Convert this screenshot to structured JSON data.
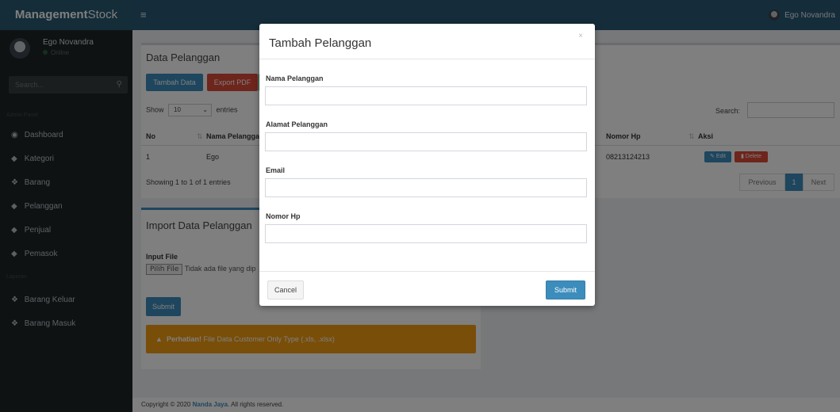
{
  "header": {
    "brand_bold": "Management",
    "brand_rest": "Stock",
    "menu_icon": "hamburger-icon",
    "user_name": "Ego Novandra"
  },
  "sidebar": {
    "user_name": "Ego Novandra",
    "status": "Online",
    "search_placeholder": "Search...",
    "section_admin": "Admin Panel",
    "section_report": "Laporan",
    "items": [
      {
        "label": "Dashboard",
        "icon": "dashboard-icon"
      },
      {
        "label": "Kategori",
        "icon": "tag-icon"
      },
      {
        "label": "Barang",
        "icon": "cubes-icon"
      },
      {
        "label": "Pelanggan",
        "icon": "tag-icon"
      },
      {
        "label": "Penjual",
        "icon": "tag-icon"
      },
      {
        "label": "Pemasok",
        "icon": "tag-icon"
      }
    ],
    "report_items": [
      {
        "label": "Barang Keluar",
        "icon": "cubes-icon"
      },
      {
        "label": "Barang Masuk",
        "icon": "cubes-icon"
      }
    ]
  },
  "data_box": {
    "title": "Data Pelanggan",
    "btn_add": "Tambah Data",
    "btn_pdf": "Export PDF",
    "show_label": "Show",
    "entries_value": "10",
    "entries_label": "entries",
    "search_label": "Search:",
    "columns": [
      "No",
      "Nama Pelanggan",
      "Nomor Hp",
      "Aksi"
    ],
    "rows": [
      {
        "no": "1",
        "nama": "Ego",
        "hp": "08213124213"
      }
    ],
    "btn_edit": "Edit",
    "btn_delete": "Delete",
    "info": "Showing 1 to 1 of 1 entries",
    "pager": {
      "prev": "Previous",
      "page": "1",
      "next": "Next"
    }
  },
  "import_box": {
    "title": "Import Data Pelanggan",
    "input_label": "Input File",
    "file_btn": "Pilih File",
    "file_text": "Tidak ada file yang dip",
    "submit": "Submit",
    "alert_bold": "Perhatian!",
    "alert_text": "File Data Customer Only Type (.xls, .xlsx)"
  },
  "footer": {
    "prefix": "Copyright © 2020 ",
    "link": "Nanda Jaya",
    "suffix": ". All rights reserved."
  },
  "modal": {
    "title": "Tambah Pelanggan",
    "close": "×",
    "fields": [
      {
        "label": "Nama Pelanggan",
        "value": ""
      },
      {
        "label": "Alamat Pelanggan",
        "value": ""
      },
      {
        "label": "Email",
        "value": ""
      },
      {
        "label": "Nomor Hp",
        "value": ""
      }
    ],
    "cancel": "Cancel",
    "submit": "Submit"
  },
  "colors": {
    "primary": "#3c8dbc",
    "danger": "#dd4b39",
    "warning": "#f39c12",
    "header": "#3c8dbc"
  }
}
